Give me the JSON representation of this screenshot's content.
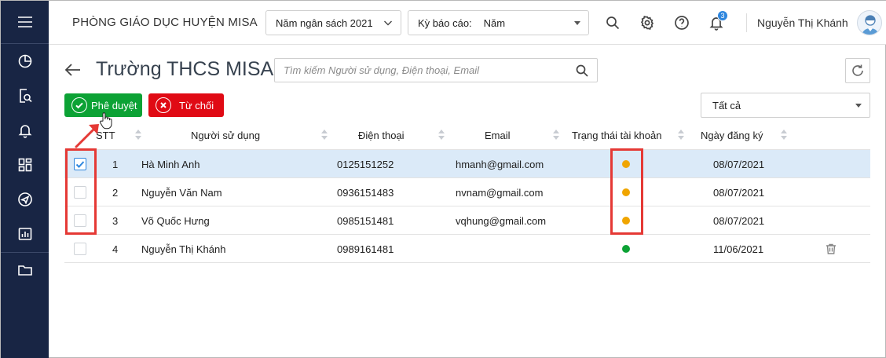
{
  "sidebar": {
    "items": [
      {
        "icon": "menu-icon"
      },
      {
        "icon": "pie-chart-icon"
      },
      {
        "icon": "document-search-icon"
      },
      {
        "icon": "bell-icon"
      },
      {
        "icon": "dashboard-icon"
      },
      {
        "icon": "send-icon"
      },
      {
        "icon": "report-icon"
      },
      {
        "icon": "folder-icon"
      }
    ]
  },
  "header": {
    "org_name": "PHÒNG GIÁO DỤC HUYỆN MISA",
    "budget_year": "Năm ngân sách 2021",
    "report_period_label": "Kỳ báo cáo:",
    "report_period_value": "Năm",
    "notification_count": "3",
    "user_name": "Nguyễn Thị Khánh"
  },
  "page": {
    "title": "Trường THCS MISA",
    "search_placeholder": "Tìm kiếm Người sử dụng, Điện thoại, Email"
  },
  "actions": {
    "approve_label": "Phê duyệt",
    "reject_label": "Từ chối",
    "filter_value": "Tất cả"
  },
  "table": {
    "columns": {
      "stt": "STT",
      "user": "Người sử dụng",
      "phone": "Điện thoại",
      "email": "Email",
      "status": "Trạng thái tài khoản",
      "reg_date": "Ngày đăng ký"
    },
    "rows": [
      {
        "checked": true,
        "stt": "1",
        "user": "Hà Minh Anh",
        "phone": "0125151252",
        "email": "hmanh@gmail.com",
        "status_color": "#f0a500",
        "reg_date": "08/07/2021"
      },
      {
        "checked": false,
        "stt": "2",
        "user": "Nguyễn Văn Nam",
        "phone": "0936151483",
        "email": "nvnam@gmail.com",
        "status_color": "#f0a500",
        "reg_date": "08/07/2021"
      },
      {
        "checked": false,
        "stt": "3",
        "user": "Võ Quốc Hưng",
        "phone": "0985151481",
        "email": "vqhung@gmail.com",
        "status_color": "#f0a500",
        "reg_date": "08/07/2021"
      },
      {
        "checked": false,
        "stt": "4",
        "user": "Nguyễn Thị Khánh",
        "phone": "0989161481",
        "email": "",
        "status_color": "#0ca235",
        "reg_date": "11/06/2021"
      }
    ]
  },
  "colors": {
    "sidebar_bg": "#182544",
    "approve": "#0ca235",
    "reject": "#e00a14",
    "pending": "#f0a500",
    "active": "#0ca235",
    "selected_row": "#dbeaf8",
    "annotation": "#e53935"
  }
}
